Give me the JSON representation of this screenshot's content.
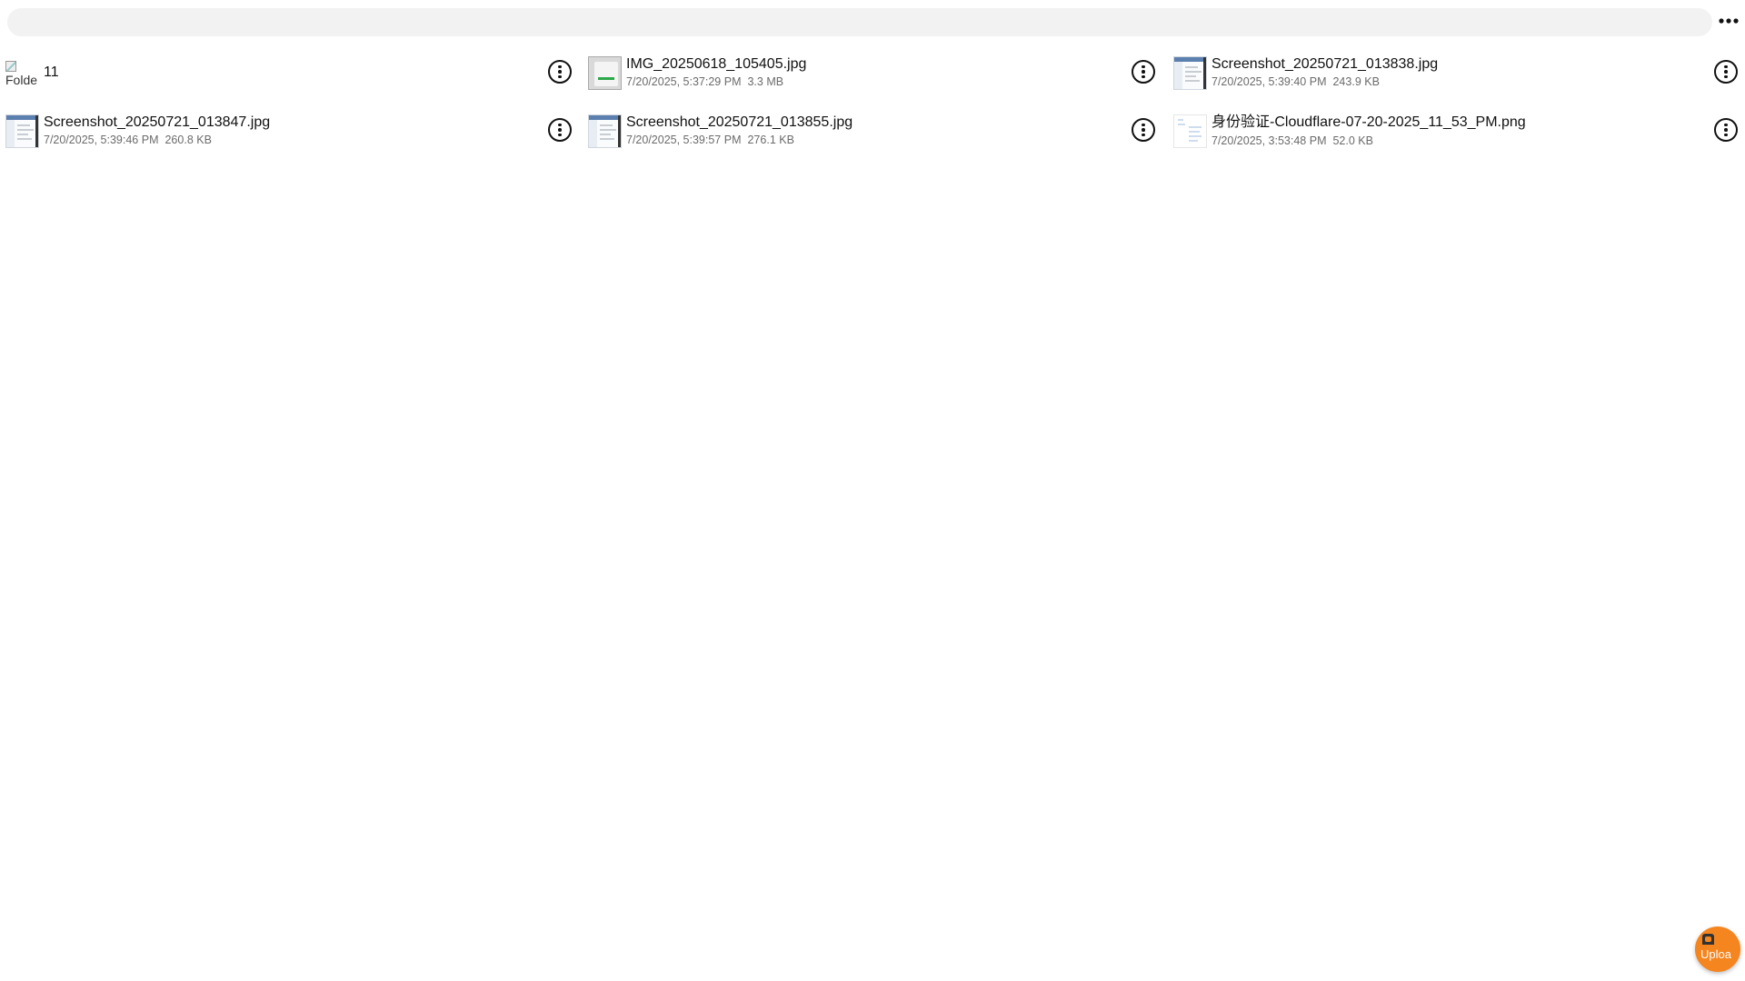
{
  "toolbar": {
    "path": "",
    "more_icon": "more-horizontal-icon"
  },
  "items": [
    {
      "type": "folder",
      "thumb_alt": "Folde",
      "name": "11"
    },
    {
      "type": "photo",
      "name": "IMG_20250618_105405.jpg",
      "date": "7/20/2025, 5:37:29 PM",
      "size": "3.3 MB"
    },
    {
      "type": "shot",
      "name": "Screenshot_20250721_013838.jpg",
      "date": "7/20/2025, 5:39:40 PM",
      "size": "243.9 KB"
    },
    {
      "type": "shot",
      "name": "Screenshot_20250721_013847.jpg",
      "date": "7/20/2025, 5:39:46 PM",
      "size": "260.8 KB"
    },
    {
      "type": "shot",
      "name": "Screenshot_20250721_013855.jpg",
      "date": "7/20/2025, 5:39:57 PM",
      "size": "276.1 KB"
    },
    {
      "type": "png",
      "name": "身份验证-Cloudflare-07-20-2025_11_53_PM.png",
      "date": "7/20/2025, 3:53:48 PM",
      "size": "52.0 KB"
    }
  ],
  "upload": {
    "label": "Uploa",
    "icon": "upload-icon",
    "color": "#f4851f"
  }
}
